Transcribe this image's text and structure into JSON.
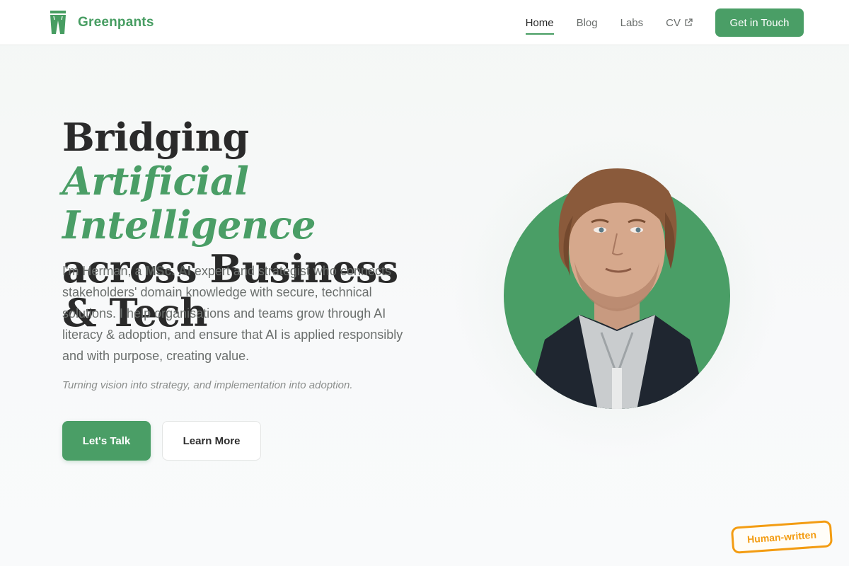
{
  "brand": {
    "name": "Greenpants",
    "logo_icon": "pants-icon",
    "color": "#479d62"
  },
  "nav": {
    "items": [
      {
        "label": "Home",
        "active": true
      },
      {
        "label": "Blog",
        "active": false
      },
      {
        "label": "Labs",
        "active": false
      },
      {
        "label": "CV",
        "active": false,
        "icon": "external-link-icon"
      }
    ],
    "cta_label": "Get in Touch"
  },
  "hero": {
    "title_part1": "Bridging",
    "title_accent": "Artificial Intelligence",
    "title_part2": "across Business & Tech",
    "desc_intro": "I'm Herman, a ",
    "desc_bold": "MSc. AI",
    "desc_rest": " expert and strategist who connects stakeholders' domain knowledge with secure, technical solutions. I help organisations and teams grow through AI literacy & adoption, and ensure that AI is applied responsibly and with purpose, creating value.",
    "tagline": "Turning vision into strategy, and implementation into adoption.",
    "primary_button": "Let's Talk",
    "secondary_button": "Learn More",
    "portrait_icon": "portrait-photo"
  },
  "badge": {
    "label": "Human-written",
    "color": "#f39c12"
  },
  "colors": {
    "accent": "#4a9e66",
    "text": "#2a2a2a",
    "muted": "#6b6f6d"
  }
}
